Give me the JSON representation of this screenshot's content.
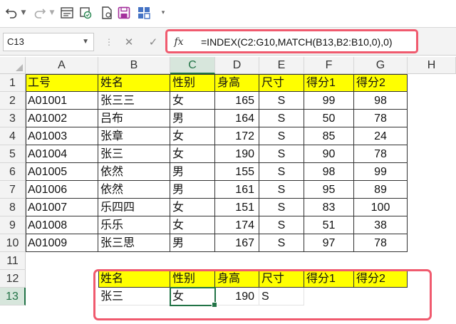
{
  "toolbar": {
    "undo_icon": "undo-icon",
    "redo_icon": "redo-icon",
    "form_icon": "form-icon",
    "autosave_icon": "autosave-icon",
    "doc_icon": "document-icon",
    "save_icon": "save-icon",
    "grid_icon": "table-grid-icon",
    "customize_icon": "chevron-down-icon",
    "accent_save": "#a4309c"
  },
  "formula_bar": {
    "name_box": "C13",
    "fx_label": "fx",
    "formula": "=INDEX(C2:G10,MATCH(B13,B2:B10,0),0)"
  },
  "columns": [
    "A",
    "B",
    "C",
    "D",
    "E",
    "F",
    "G",
    "H"
  ],
  "rows": [
    "1",
    "2",
    "3",
    "4",
    "5",
    "6",
    "7",
    "8",
    "9",
    "10",
    "11",
    "12",
    "13"
  ],
  "table": {
    "headers": [
      "工号",
      "姓名",
      "性别",
      "身高",
      "尺寸",
      "得分1",
      "得分2"
    ],
    "data": [
      [
        "A01001",
        "张三三",
        "女",
        "165",
        "S",
        "99",
        "98"
      ],
      [
        "A01002",
        "吕布",
        "男",
        "164",
        "S",
        "50",
        "78"
      ],
      [
        "A01003",
        "张章",
        "女",
        "172",
        "S",
        "85",
        "24"
      ],
      [
        "A01004",
        "张三",
        "女",
        "190",
        "S",
        "90",
        "78"
      ],
      [
        "A01005",
        "依然",
        "男",
        "155",
        "S",
        "98",
        "99"
      ],
      [
        "A01006",
        "依然",
        "男",
        "161",
        "S",
        "95",
        "89"
      ],
      [
        "A01007",
        "乐四四",
        "女",
        "151",
        "S",
        "83",
        "100"
      ],
      [
        "A01008",
        "乐乐",
        "女",
        "174",
        "S",
        "51",
        "38"
      ],
      [
        "A01009",
        "张三思",
        "男",
        "167",
        "S",
        "97",
        "78"
      ]
    ]
  },
  "lookup": {
    "headers": [
      "姓名",
      "性别",
      "身高",
      "尺寸",
      "得分1",
      "得分2"
    ],
    "values": [
      "张三",
      "女",
      "190",
      "S"
    ]
  },
  "colors": {
    "header_fill": "#ffff00",
    "highlight": "#f05a6e",
    "selection": "#217346"
  }
}
